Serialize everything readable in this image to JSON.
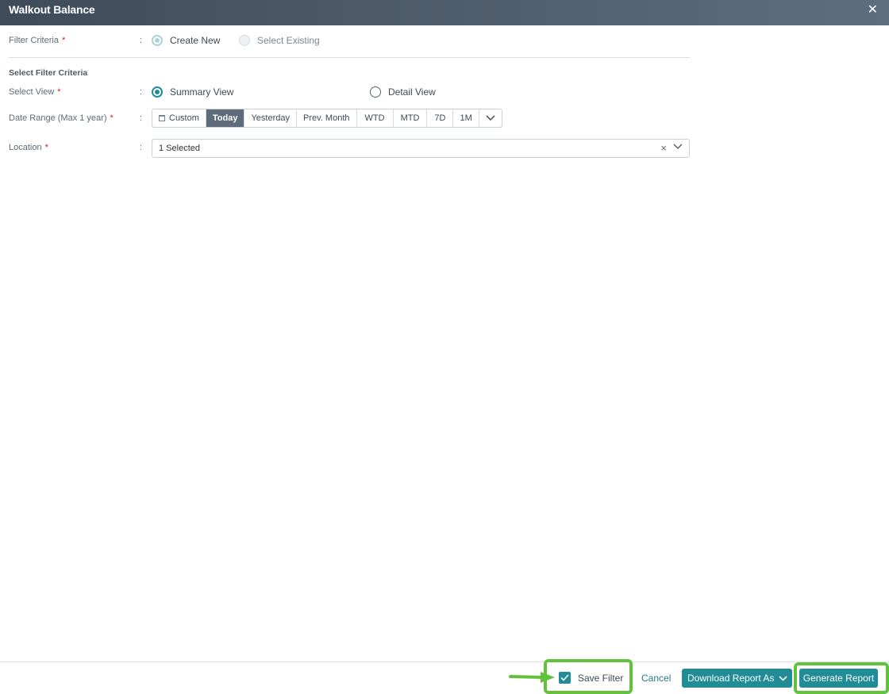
{
  "window": {
    "title": "Walkout Balance",
    "close_glyph": "✕"
  },
  "filter_criteria": {
    "label": "Filter Criteria",
    "required_mark": "*",
    "colon": ":",
    "options": [
      {
        "label": "Create New",
        "selected": true
      },
      {
        "label": "Select Existing",
        "selected": false
      }
    ]
  },
  "section": {
    "title": "Select Filter Criteria"
  },
  "select_view": {
    "label": "Select View",
    "required_mark": "*",
    "colon": ":",
    "options": [
      {
        "label": "Summary View",
        "selected": true
      },
      {
        "label": "Detail View",
        "selected": false
      }
    ]
  },
  "date_range": {
    "label": "Date Range (Max 1 year)",
    "required_mark": "*",
    "colon": ":",
    "buttons": [
      "Custom",
      "Today",
      "Yesterday",
      "Prev. Month",
      "WTD",
      "MTD",
      "7D",
      "1M"
    ],
    "active": "Today"
  },
  "location": {
    "label": "Location",
    "required_mark": "*",
    "colon": ":",
    "value": "1 Selected",
    "clear_glyph": "×"
  },
  "footer": {
    "save_filter_label": "Save Filter",
    "save_filter_checked": true,
    "cancel_label": "Cancel",
    "download_label": "Download Report As",
    "generate_label": "Generate Report"
  },
  "colors": {
    "accent": "#1f8c96",
    "titlebar_start": "#3f4b59",
    "titlebar_end": "#5d6e80",
    "highlight": "#62c23c",
    "required": "#d02020"
  },
  "icons": [
    "close-icon",
    "calendar-icon",
    "chevron-down-icon",
    "clear-icon",
    "check-icon",
    "arrow-annotation-icon"
  ]
}
